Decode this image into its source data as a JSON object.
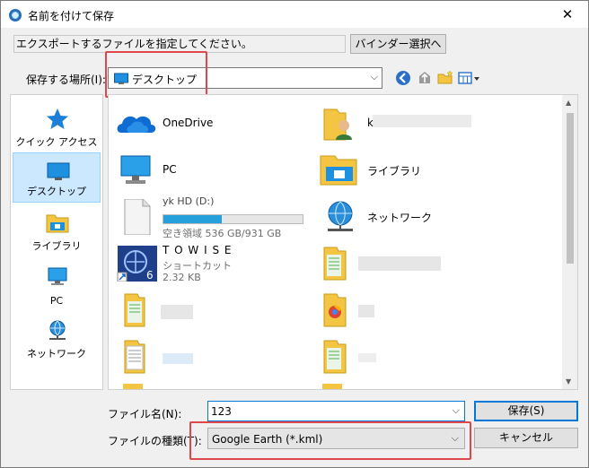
{
  "window": {
    "title": "名前を付けて保存",
    "close_glyph": "✕"
  },
  "instruction": {
    "text": "エクスポートするファイルを指定してください。",
    "binder_button": "バインダー選択へ"
  },
  "location": {
    "label": "保存する場所(I):",
    "value": "デスクトップ",
    "arrow": "⌵"
  },
  "toolbar_icons": [
    "back-icon",
    "up-folder-icon",
    "new-folder-icon",
    "view-menu-icon"
  ],
  "nav": [
    {
      "id": "quick",
      "label": "クイック アクセス",
      "icon": "star-icon"
    },
    {
      "id": "desktop",
      "label": "デスクトップ",
      "icon": "desktop-icon",
      "selected": true
    },
    {
      "id": "library",
      "label": "ライブラリ",
      "icon": "library-icon"
    },
    {
      "id": "pc",
      "label": "PC",
      "icon": "pc-icon"
    },
    {
      "id": "network",
      "label": "ネットワーク",
      "icon": "network-icon"
    }
  ],
  "files": {
    "onedrive": "OneDrive",
    "user_initial": "k",
    "pc": "PC",
    "library": "ライブラリ",
    "drive_name": "yk HD (D:)",
    "drive_free": "空き領域 536 GB/931 GB",
    "drive_used_fraction": 0.42,
    "network": "ネットワーク",
    "towise_name": "T O W I S E",
    "towise_type": "ショートカット",
    "towise_size": "2.32 KB"
  },
  "filename": {
    "label": "ファイル名(N):",
    "value": "123"
  },
  "filetype": {
    "label": "ファイルの種類(T):",
    "value": "Google Earth (*.kml)"
  },
  "buttons": {
    "save": "保存(S)",
    "cancel": "キャンセル"
  },
  "colors": {
    "accent": "#0078d7",
    "highlight": "#e0474c",
    "selection": "#cce8ff"
  }
}
